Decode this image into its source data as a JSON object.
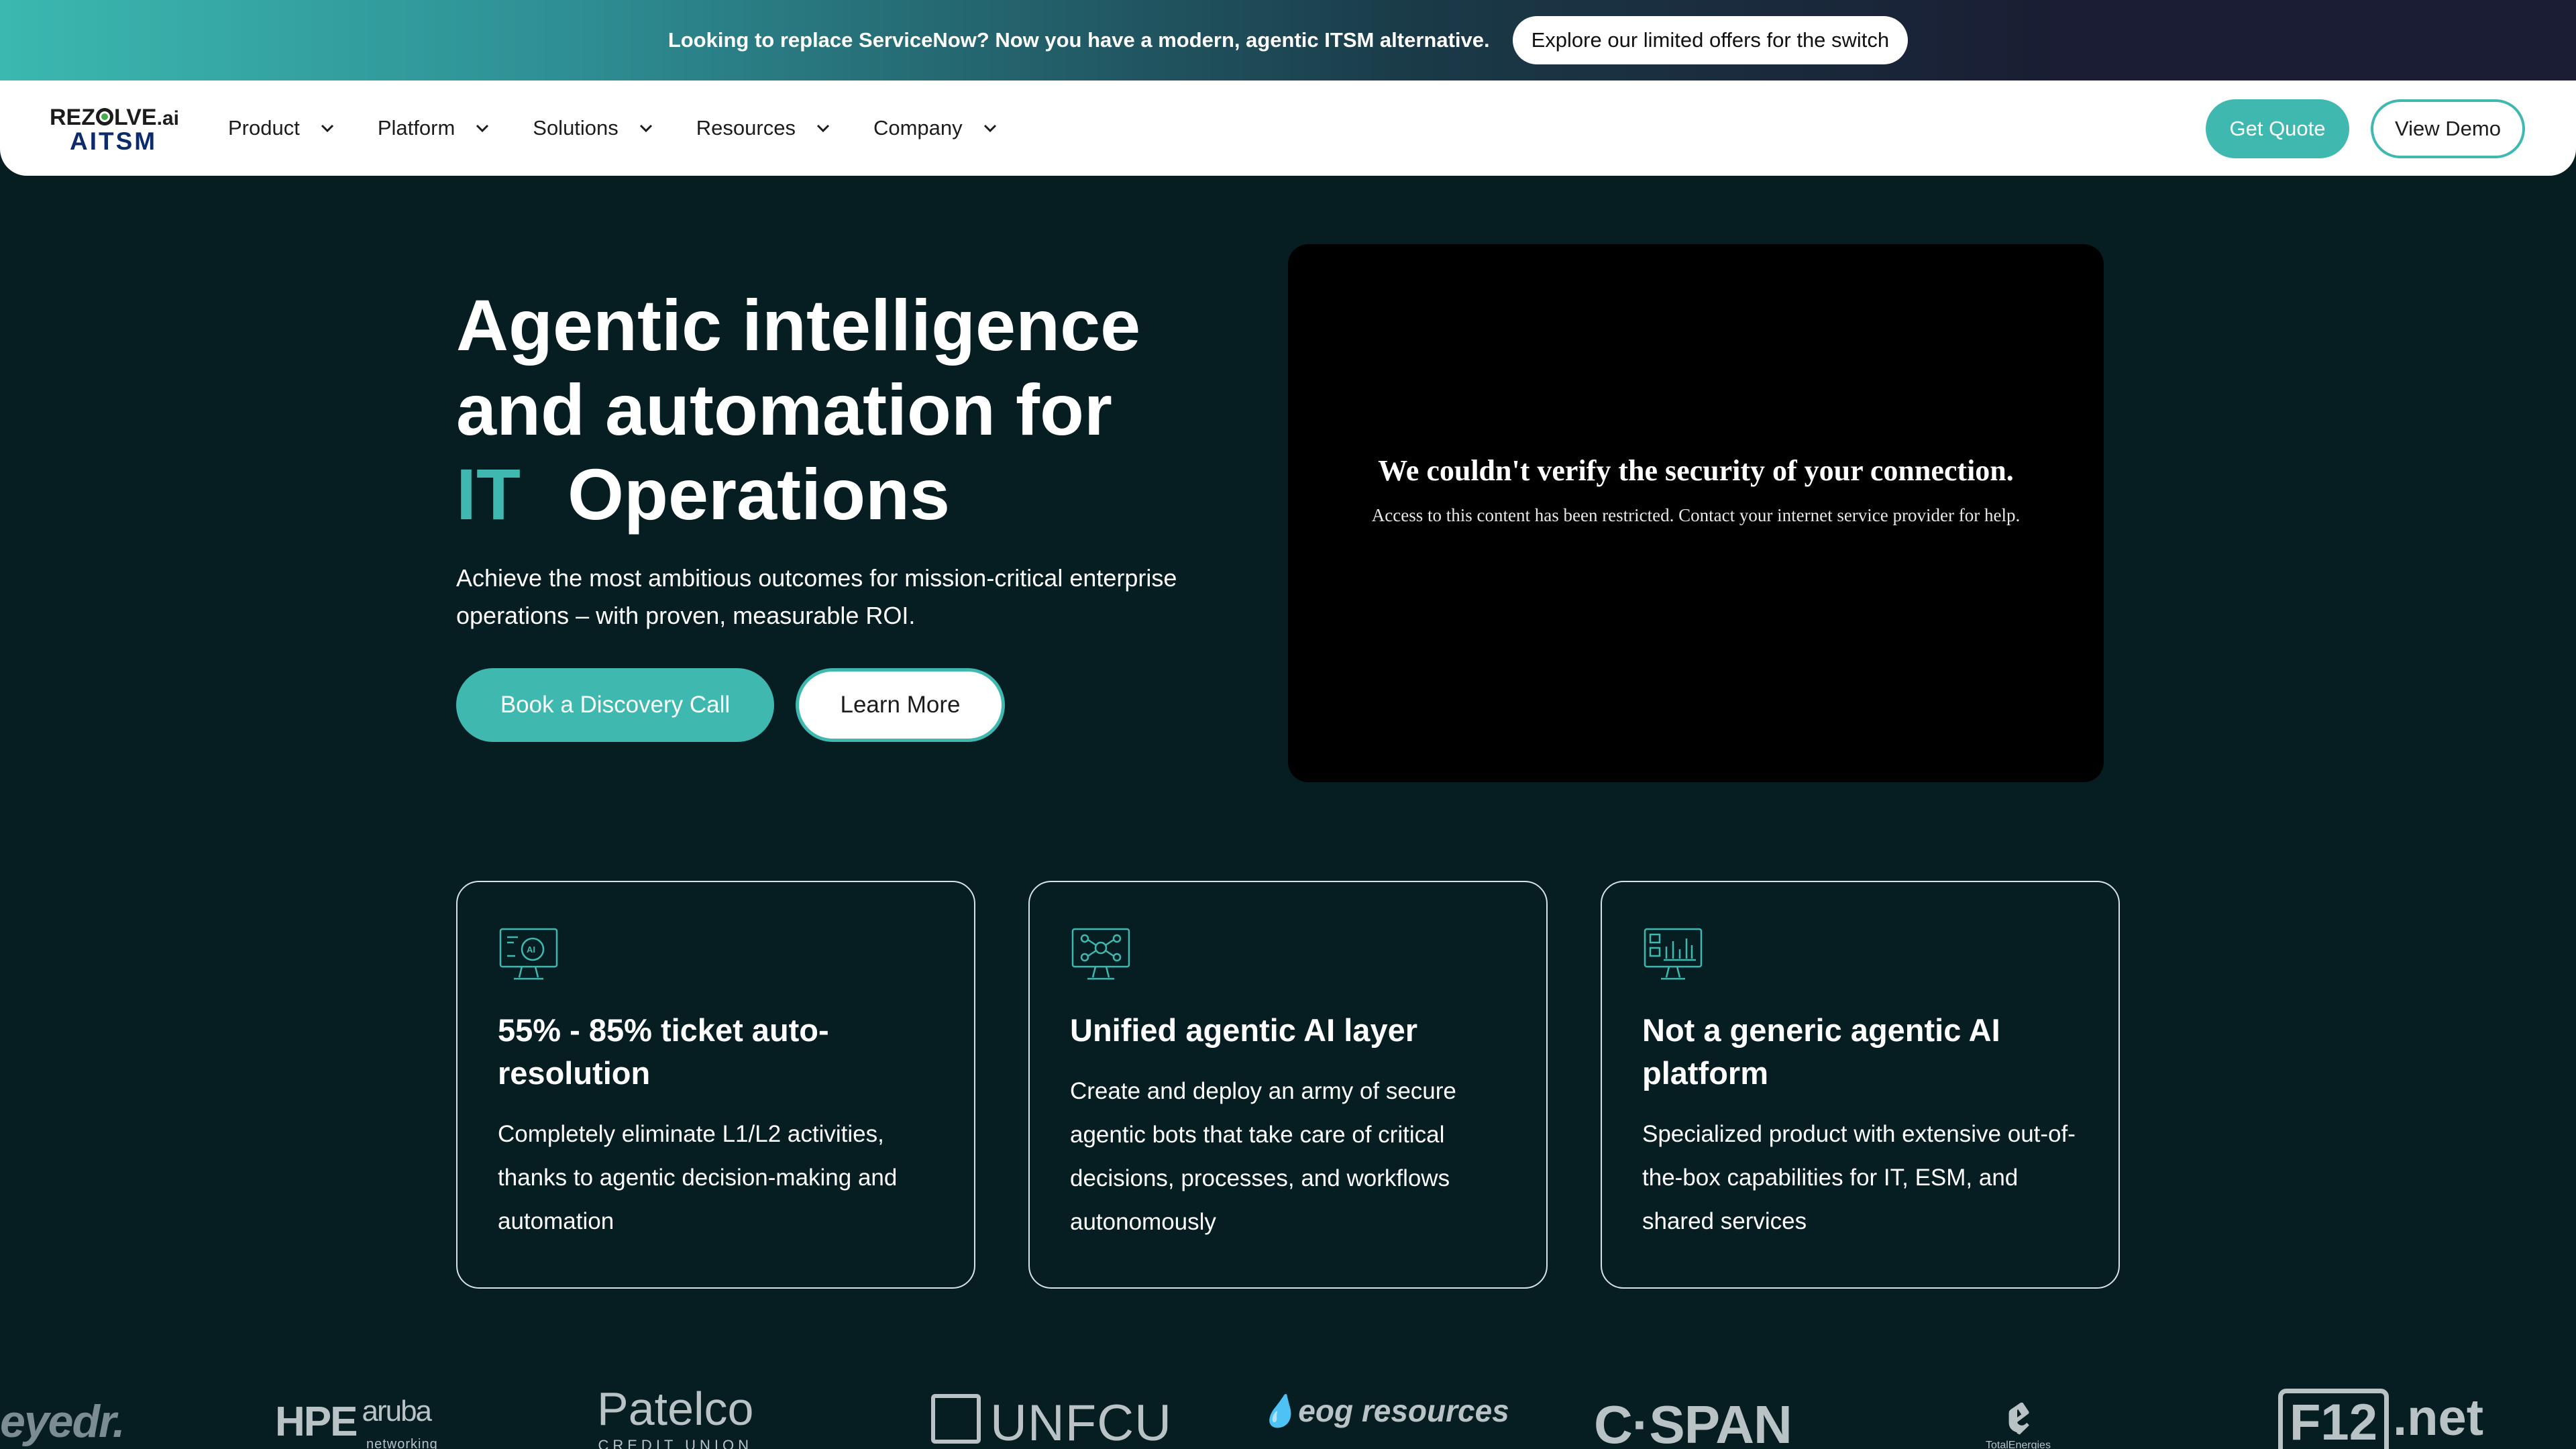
{
  "announcement": {
    "text": "Looking to replace ServiceNow? Now you have a modern, agentic ITSM alternative.",
    "cta": "Explore our limited offers for the switch"
  },
  "brand": {
    "logo_top_pre": "REZ",
    "logo_top_post": "LVE",
    "logo_top_suffix": ".ai",
    "logo_bottom": "AITSM"
  },
  "nav": {
    "items": [
      {
        "label": "Product"
      },
      {
        "label": "Platform"
      },
      {
        "label": "Solutions"
      },
      {
        "label": "Resources"
      },
      {
        "label": "Company"
      }
    ],
    "get_quote": "Get Quote",
    "view_demo": "View Demo"
  },
  "hero": {
    "title_line1": "Agentic intelligence",
    "title_line2": "and automation for",
    "title_accent": "IT",
    "title_line3_rest": "Operations",
    "subtitle": "Achieve the most ambitious outcomes for mission-critical enterprise operations – with proven, measurable ROI.",
    "primary_cta": "Book a Discovery Call",
    "secondary_cta": "Learn More"
  },
  "video": {
    "title": "We couldn't verify the security of your connection.",
    "message": "Access to this content has been restricted. Contact your internet service provider for help."
  },
  "cards": [
    {
      "icon": "ai-monitor-icon",
      "title": "55% - 85% ticket auto-resolution",
      "text": "Completely eliminate L1/L2 activities, thanks to agentic decision-making and automation"
    },
    {
      "icon": "agents-network-icon",
      "title": "Unified agentic AI layer",
      "text": "Create and deploy an army of secure agentic bots that take care of critical decisions, processes, and workflows autonomously"
    },
    {
      "icon": "dashboard-chart-icon",
      "title": "Not a generic agentic AI platform",
      "text": "Specialized product with extensive out-of-the-box capabilities for IT, ESM, and shared services"
    }
  ],
  "customer_logos": {
    "eyedr": "eyedr.",
    "hpe": "HPE",
    "aruba": "aruba",
    "aruba_sub": "networking",
    "patelco": "Patelco",
    "patelco_sub": "CREDIT UNION",
    "unfcu": "UNFCU",
    "eog": "eog resources",
    "cspan": "C·SPAN",
    "total_sub": "TotalEnergies",
    "f12": "F12",
    "f12_suffix": ".net"
  },
  "colors": {
    "accent": "#3fb8b0",
    "background": "#061e22",
    "nav_bg": "#ffffff"
  }
}
